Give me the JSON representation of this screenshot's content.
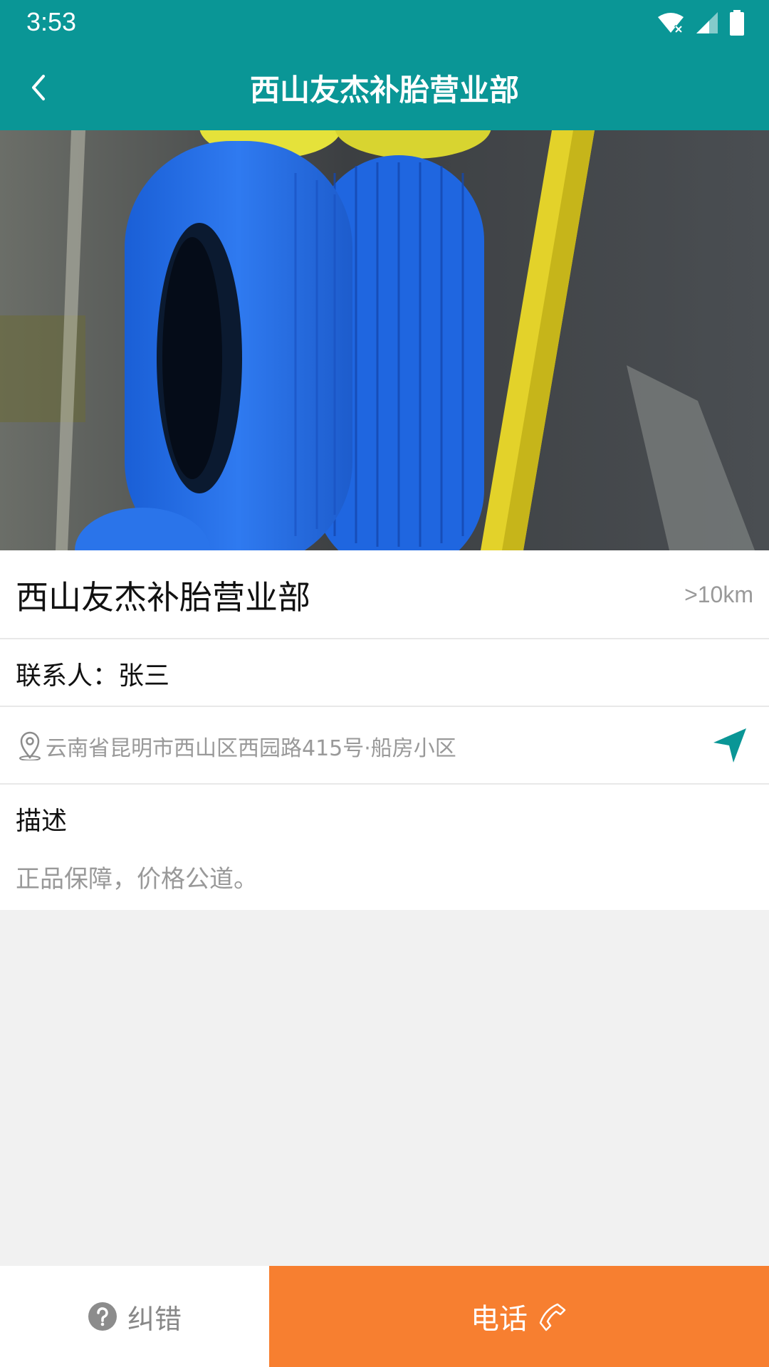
{
  "status_bar": {
    "time": "3:53",
    "icons": [
      "wifi-icon",
      "signal-icon",
      "battery-icon"
    ]
  },
  "app_bar": {
    "title": "西山友杰补胎营业部",
    "back_icon": "chevron-left-icon"
  },
  "hero": {
    "image": "photo of blue and yellow tires"
  },
  "shop": {
    "name": "西山友杰补胎营业部",
    "distance": ">10km",
    "contact": "联系人：张三",
    "address": "云南省昆明市西山区西园路415号·船房小区"
  },
  "description": {
    "heading": "描述",
    "text": "正品保障，价格公道。"
  },
  "bottom_bar": {
    "report_label": "纠错",
    "call_label": "电话"
  },
  "colors": {
    "primary": "#0a9696",
    "call": "#f77f30",
    "muted_text": "#999999"
  }
}
